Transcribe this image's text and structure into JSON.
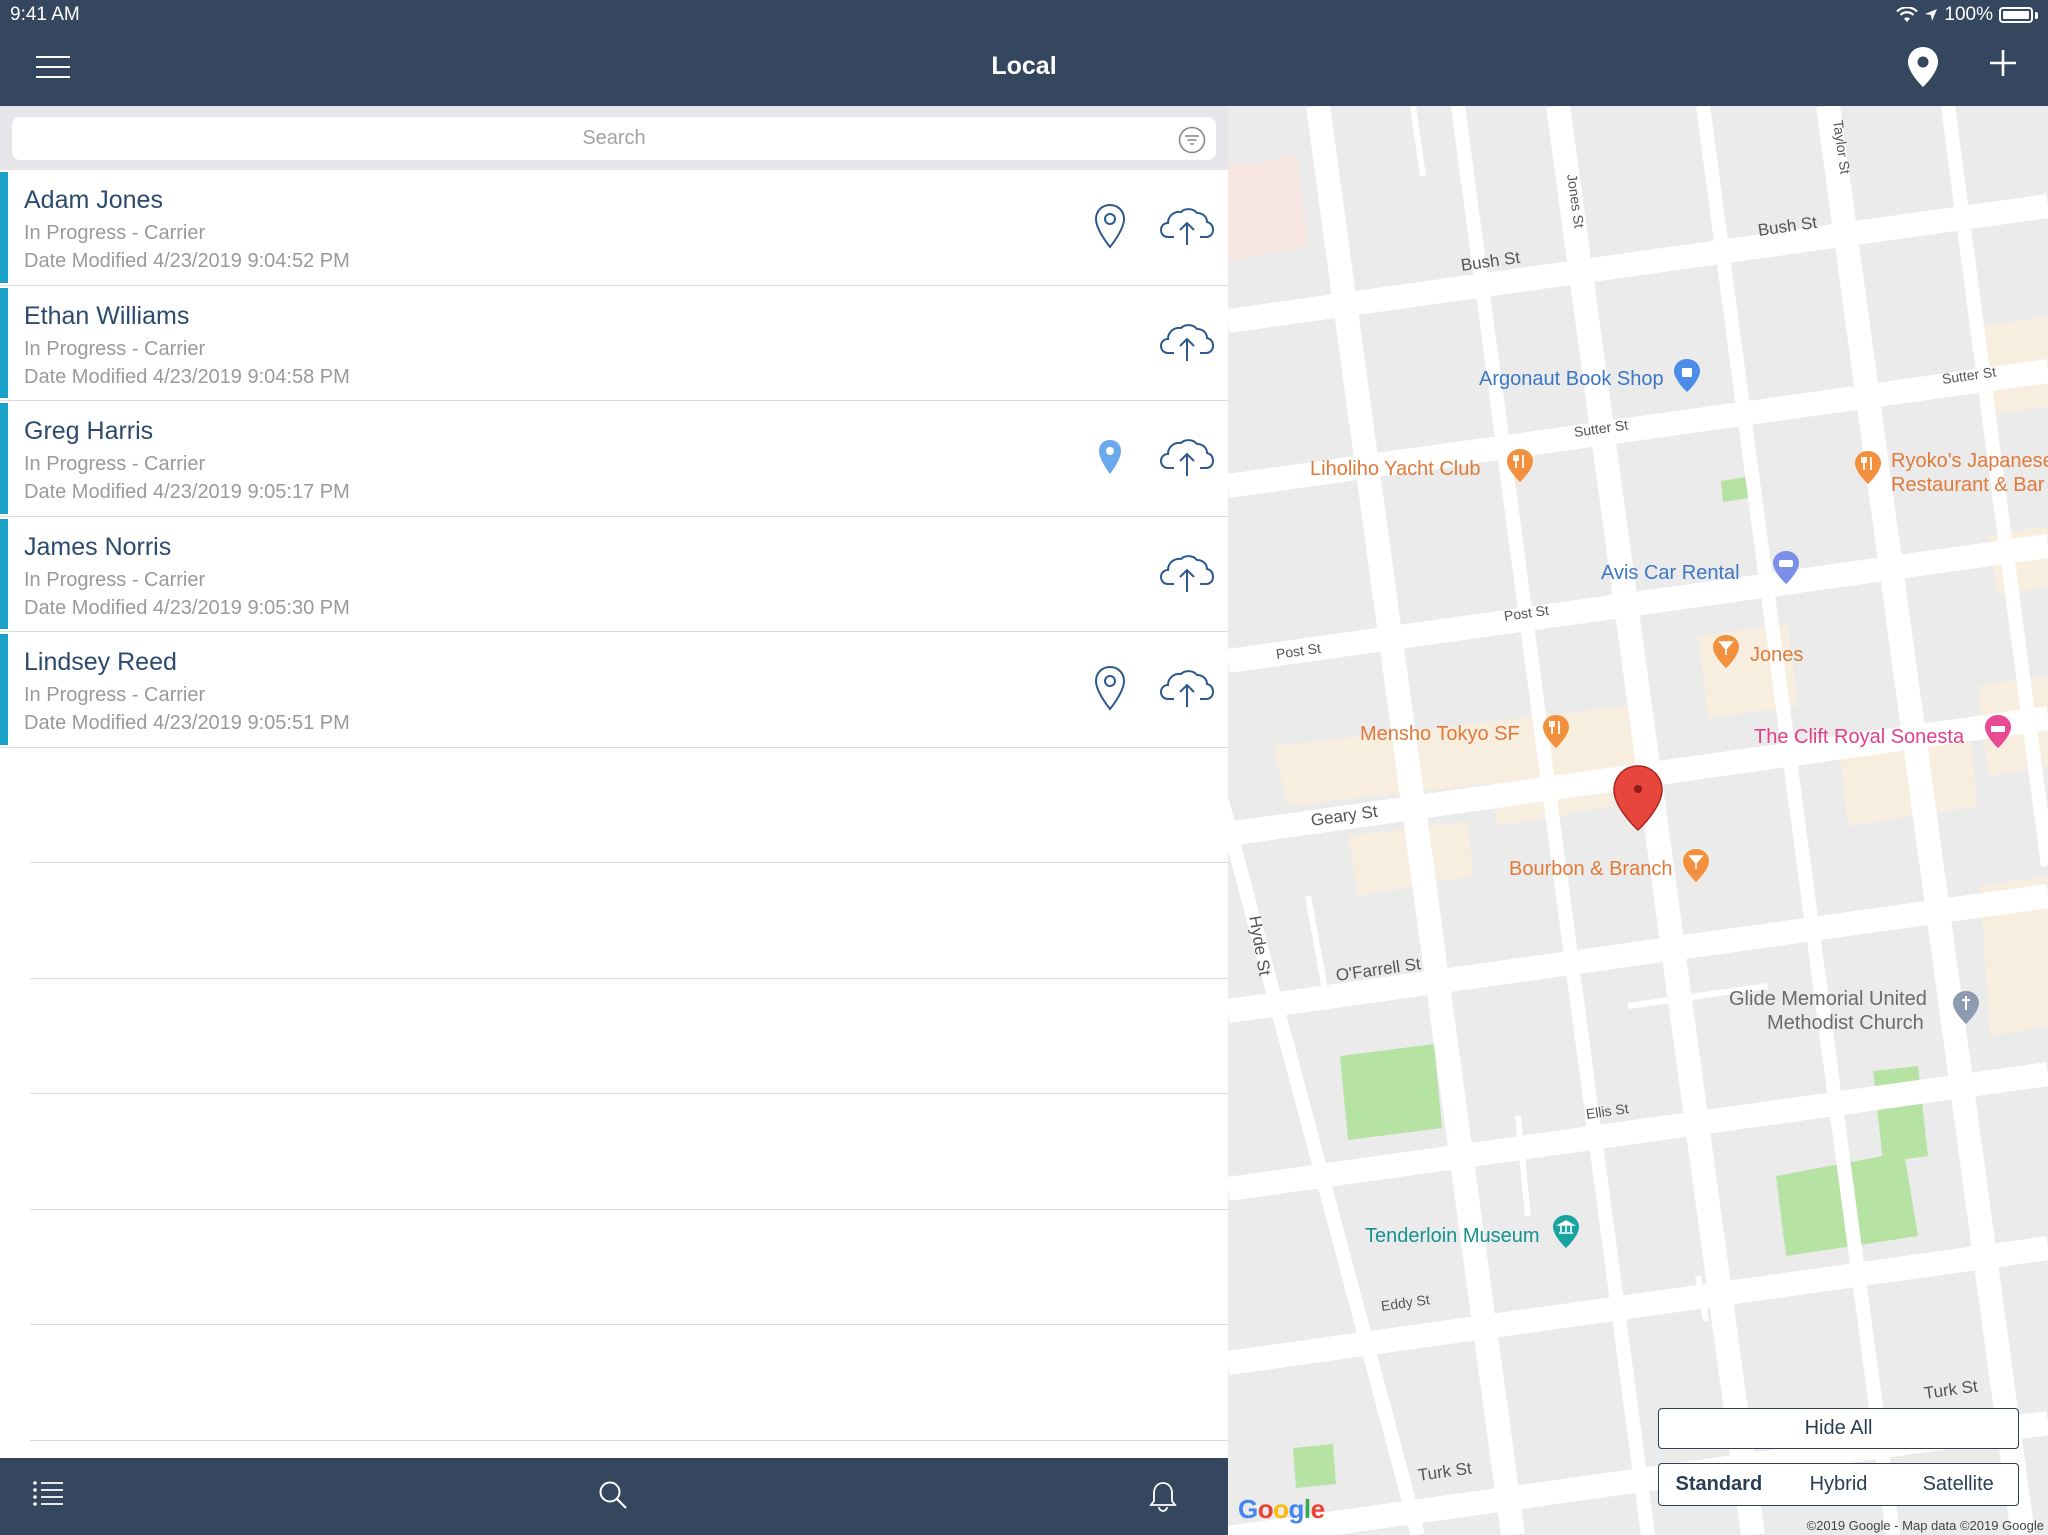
{
  "status_bar": {
    "time": "9:41 AM",
    "battery": "100%"
  },
  "nav": {
    "title": "Local"
  },
  "search": {
    "placeholder": "Search"
  },
  "records": [
    {
      "name": "Adam Jones",
      "status": "In Progress  -  Carrier",
      "date": "Date Modified 4/23/2019 9:04:52 PM",
      "location": "outline"
    },
    {
      "name": "Ethan Williams",
      "status": "In Progress  -  Carrier",
      "date": "Date Modified 4/23/2019 9:04:58 PM",
      "location": "none"
    },
    {
      "name": "Greg Harris",
      "status": "In Progress  -  Carrier",
      "date": "Date Modified 4/23/2019 9:05:17 PM",
      "location": "filled"
    },
    {
      "name": "James Norris",
      "status": "In Progress  -  Carrier",
      "date": "Date Modified 4/23/2019 9:05:30 PM",
      "location": "none"
    },
    {
      "name": "Lindsey Reed",
      "status": "In Progress  -  Carrier",
      "date": "Date Modified 4/23/2019 9:05:51 PM",
      "location": "outline"
    }
  ],
  "tabbar": {
    "icons": [
      "list-icon",
      "search-icon",
      "bell-icon"
    ]
  },
  "map": {
    "pois": {
      "argonaut": "Argonaut Book Shop",
      "liholiho": "Liholiho Yacht Club",
      "ryoko1": "Ryoko's Japanese",
      "ryoko2": "Restaurant & Bar",
      "avis": "Avis Car Rental",
      "jones": "Jones",
      "mensho": "Mensho Tokyo SF",
      "clift": "The Clift Royal Sonesta",
      "bourbon": "Bourbon & Branch",
      "glide1": "Glide Memorial United",
      "glide2": "Methodist Church",
      "tenderloin": "Tenderloin Museum"
    },
    "streets": {
      "bush1": "Bush St",
      "bush2": "Bush St",
      "sutter1": "Sutter St",
      "sutter2": "Sutter St",
      "post1": "Post St",
      "post2": "Post St",
      "geary": "Geary St",
      "ofarrell": "O'Farrell St",
      "ellis": "Ellis St",
      "eddy": "Eddy St",
      "turk1": "Turk St",
      "turk2": "Turk St",
      "hyde": "Hyde St",
      "jones": "Jones St",
      "taylor": "Taylor St"
    },
    "hide_all": "Hide All",
    "segments": [
      "Standard",
      "Hybrid",
      "Satellite"
    ],
    "selected_segment": "Standard",
    "google": "Google",
    "copyright": "©2019 Google - Map data ©2019 Google"
  },
  "colors": {
    "navbar": "#34475e",
    "accent": "#1aa1c8",
    "name_text": "#2c4a6e"
  }
}
